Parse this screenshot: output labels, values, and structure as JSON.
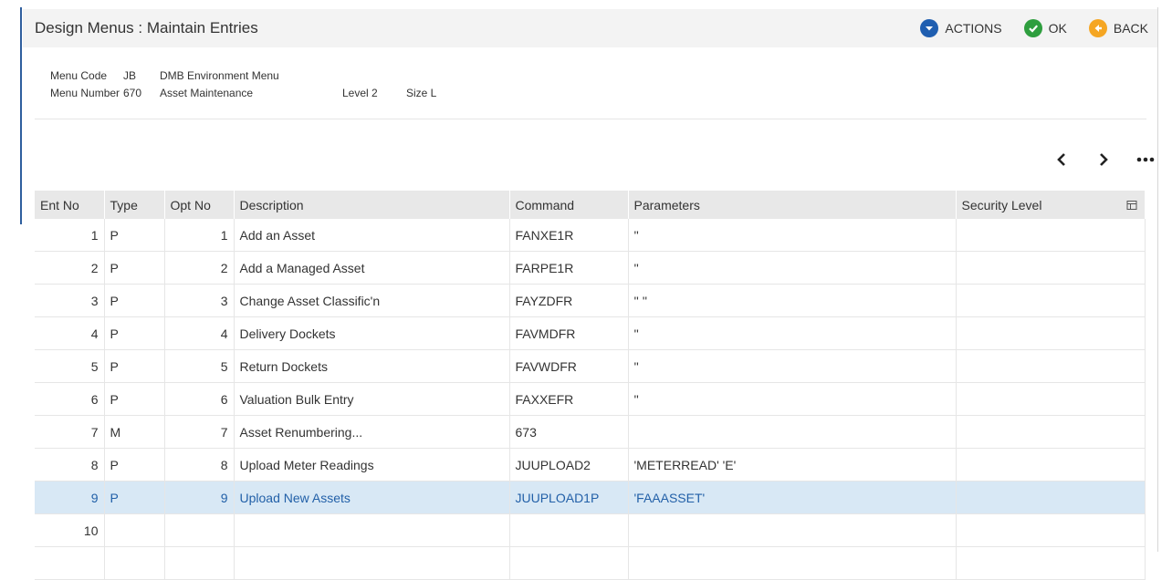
{
  "header": {
    "title": "Design Menus : Maintain Entries",
    "actions_label": "ACTIONS",
    "ok_label": "OK",
    "back_label": "BACK"
  },
  "info": {
    "menu_code_label": "Menu Code",
    "menu_code": "JB",
    "menu_code_desc": "DMB Environment Menu",
    "menu_number_label": "Menu Number",
    "menu_number": "670",
    "menu_number_desc": "Asset Maintenance",
    "level": "Level  2",
    "size": "Size  L"
  },
  "table": {
    "columns": [
      "Ent No",
      "Type",
      "Opt No",
      "Description",
      "Command",
      "Parameters",
      "Security Level"
    ],
    "rows": [
      {
        "ent": "1",
        "type": "P",
        "opt": "1",
        "desc": "Add an Asset",
        "cmd": "FANXE1R",
        "params": "''",
        "sec": ""
      },
      {
        "ent": "2",
        "type": "P",
        "opt": "2",
        "desc": "Add a Managed Asset",
        "cmd": "FARPE1R",
        "params": "''",
        "sec": ""
      },
      {
        "ent": "3",
        "type": "P",
        "opt": "3",
        "desc": "Change Asset Classific'n",
        "cmd": "FAYZDFR",
        "params": "'' ''",
        "sec": ""
      },
      {
        "ent": "4",
        "type": "P",
        "opt": "4",
        "desc": "Delivery Dockets",
        "cmd": "FAVMDFR",
        "params": "''",
        "sec": ""
      },
      {
        "ent": "5",
        "type": "P",
        "opt": "5",
        "desc": "Return Dockets",
        "cmd": "FAVWDFR",
        "params": "''",
        "sec": ""
      },
      {
        "ent": "6",
        "type": "P",
        "opt": "6",
        "desc": "Valuation Bulk Entry",
        "cmd": "FAXXEFR",
        "params": "''",
        "sec": ""
      },
      {
        "ent": "7",
        "type": "M",
        "opt": "7",
        "desc": "Asset Renumbering...",
        "cmd": "673",
        "params": "",
        "sec": ""
      },
      {
        "ent": "8",
        "type": "P",
        "opt": "8",
        "desc": "Upload Meter Readings",
        "cmd": "JUUPLOAD2",
        "params": "'METERREAD' 'E'",
        "sec": ""
      },
      {
        "ent": "9",
        "type": "P",
        "opt": "9",
        "desc": "Upload New Assets",
        "cmd": "JUUPLOAD1P",
        "params": "'FAAASSET'",
        "sec": "",
        "selected": true
      },
      {
        "ent": "10",
        "type": "",
        "opt": "",
        "desc": "",
        "cmd": "",
        "params": "",
        "sec": ""
      },
      {
        "ent": "",
        "type": "",
        "opt": "",
        "desc": "",
        "cmd": "",
        "params": "",
        "sec": ""
      }
    ]
  },
  "colors": {
    "accent": "#1f5eb0",
    "ok": "#2e9e3e",
    "back": "#f5a623",
    "selected_row": "#d8e8f5"
  }
}
